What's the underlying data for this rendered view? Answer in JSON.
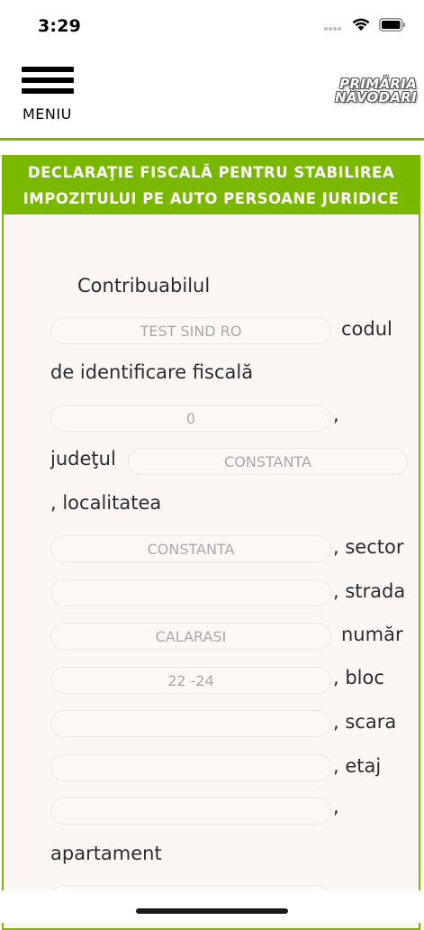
{
  "status_bar": {
    "time": "3:29"
  },
  "header": {
    "menu_label": "MENIU",
    "logo_line1": "PRIMĂRIA",
    "logo_line2": "NĂVODARI"
  },
  "form": {
    "title_line1": "DECLARAŢIE FISCALĂ PENTRU STABILIREA",
    "title_line2": "IMPOZITULUI PE AUTO PERSOANE JURIDICE",
    "labels": {
      "contribuabil": "Contribuabilul",
      "codul": "codul",
      "cod_fiscal": "de identificare fiscală",
      "comma1": ",",
      "judetul": "judeţul",
      "localitatea": ", localitatea",
      "sector": ", sector",
      "strada": ", strada",
      "numar": "număr",
      "bloc": ", bloc",
      "scara": ", scara",
      "etaj": ", etaj",
      "comma2": ",",
      "apartament": "apartament"
    },
    "values": {
      "contribuabil": "TEST SIND RO",
      "cod_fiscal": "0",
      "judet": "CONSTANTA",
      "localitate": "CONSTANTA",
      "sector": "",
      "strada": "CALARASI",
      "numar": "22 -24",
      "bloc": "",
      "scara": "",
      "etaj": "",
      "apartament": ""
    }
  }
}
